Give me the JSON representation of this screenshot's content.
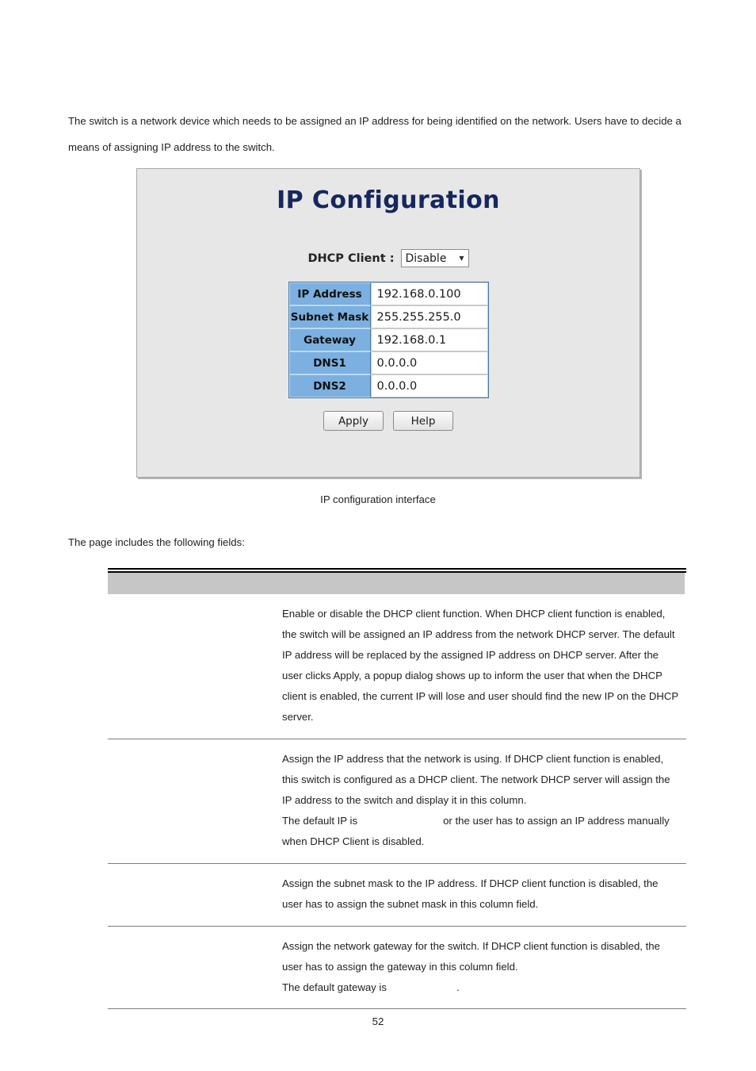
{
  "document": {
    "intro_paragraph": "The switch is a network device which needs to be assigned an IP address for being identified on the network. Users have to decide a means of assigning IP address to the switch.",
    "figure_caption": "IP configuration interface",
    "lead_in": "The page includes the following fields:",
    "page_number": "52"
  },
  "screenshot": {
    "title": "IP Configuration",
    "dhcp": {
      "label": "DHCP Client :",
      "selected": "Disable",
      "caret_icon": "chevron-down-icon"
    },
    "form_rows": [
      {
        "label": "IP Address",
        "value": "192.168.0.100"
      },
      {
        "label": "Subnet Mask",
        "value": "255.255.255.0"
      },
      {
        "label": "Gateway",
        "value": "192.168.0.1"
      },
      {
        "label": "DNS1",
        "value": "0.0.0.0"
      },
      {
        "label": "DNS2",
        "value": "0.0.0.0"
      }
    ],
    "buttons": {
      "apply": "Apply",
      "help": "Help"
    },
    "colors": {
      "panel_bg": "#e7e7e7",
      "title": "#16275e",
      "label_cell": "#7bb0e0",
      "value_cell": "#ffffff"
    }
  },
  "fields_table": {
    "header": {
      "name_col": "",
      "desc_col": ""
    },
    "rows": [
      {
        "name": "",
        "desc_1": "Enable or disable the DHCP client function. When DHCP client function is enabled, the switch will be assigned an IP address from the network DHCP server. The default IP address will be replaced by the assigned IP address on DHCP server. After the user clicks Apply, a popup dialog shows up to inform the user that when the DHCP client is enabled, the current IP will lose and user should find the new IP on the DHCP server.",
        "desc_2": ""
      },
      {
        "name": "",
        "desc_1": "Assign the IP address that the network is using. If DHCP client function is enabled, this switch is configured as a DHCP client. The network DHCP server will assign the IP address to the switch and display it in this column.",
        "desc_2_a": "The default IP is",
        "desc_2_b": "or the user has to assign an IP address manually when DHCP Client is disabled."
      },
      {
        "name": "",
        "desc_1": "Assign the subnet mask to the IP address. If DHCP client function is disabled, the user has to assign the subnet mask in this column field.",
        "desc_2": ""
      },
      {
        "name": "",
        "desc_1": "Assign the network gateway for the switch. If DHCP client function is disabled, the user has to assign the gateway in this column field.",
        "desc_2_a": "The default gateway is",
        "desc_2_b": "."
      }
    ]
  }
}
